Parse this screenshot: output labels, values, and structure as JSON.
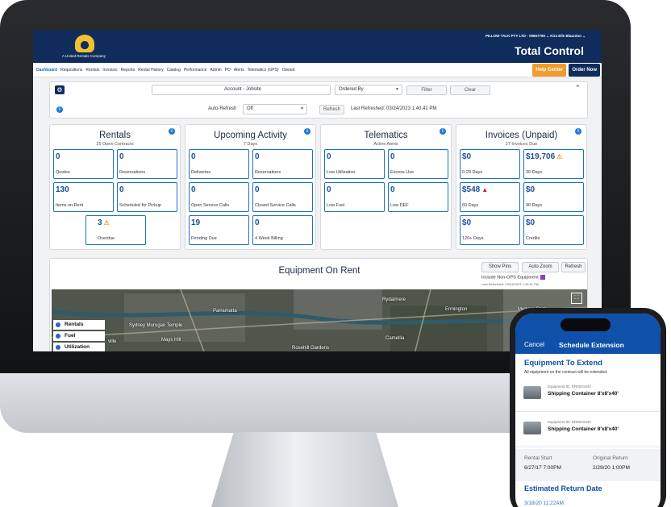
{
  "app": {
    "brand_subtitle": "A United Rentals Company",
    "account_menu": "PILLOW TALK PTY LTD - #8567790 ⌄   Kira Elle Blaunton ⌄",
    "title": "Total Control"
  },
  "nav": {
    "items": [
      "Dashboard",
      "Requisitions",
      "Rentals",
      "Invoices",
      "Reports",
      "Rental History",
      "Catalog",
      "Performance",
      "Admin",
      "PO",
      "Alerts",
      "Telematics (GPS)",
      "Owned"
    ],
    "help_center": "Help Center",
    "order_now": "Order Now"
  },
  "filters": {
    "account_jobsite_placeholder": "Account - Jobsite",
    "ordered_by": "Ordered By",
    "filter_button": "Filter",
    "clear_button": "Clear",
    "auto_refresh_label": "Auto-Refresh",
    "auto_refresh_value": "Off",
    "refresh_button": "Refresh",
    "last_refreshed": "Last Refreshed: 03/24/2023 1:40:41 PM"
  },
  "cards": {
    "rentals": {
      "title": "Rentals",
      "subtitle": "25 Open Contracts",
      "tiles": [
        {
          "value": "0",
          "label": "Quotes"
        },
        {
          "value": "0",
          "label": "Reservations"
        },
        {
          "value": "130",
          "label": "Items on Rent"
        },
        {
          "value": "0",
          "label": "Scheduled for Pickup"
        },
        {
          "value": "3",
          "label": "Overdue"
        }
      ]
    },
    "upcoming": {
      "title": "Upcoming Activity",
      "subtitle": "7 Days",
      "tiles": [
        {
          "value": "0",
          "label": "Deliveries"
        },
        {
          "value": "0",
          "label": "Reservations"
        },
        {
          "value": "0",
          "label": "Open Service Calls"
        },
        {
          "value": "0",
          "label": "Closed Service Calls"
        },
        {
          "value": "19",
          "label": "Pending Due"
        },
        {
          "value": "0",
          "label": "4 Week Billing"
        }
      ]
    },
    "telematics": {
      "title": "Telematics",
      "subtitle": "Active Alerts",
      "tiles": [
        {
          "value": "0",
          "label": "Low Utilization"
        },
        {
          "value": "0",
          "label": "Excess Use"
        },
        {
          "value": "0",
          "label": "Low Fuel"
        },
        {
          "value": "0",
          "label": "Low DEF"
        }
      ]
    },
    "invoices": {
      "title": "Invoices (Unpaid)",
      "subtitle": "27 Invoices Due",
      "tiles": [
        {
          "value": "$0",
          "label": "0-29 Days"
        },
        {
          "value": "$19,706",
          "label": "30 Days"
        },
        {
          "value": "$548",
          "label": "60 Days"
        },
        {
          "value": "$0",
          "label": "90 Days"
        },
        {
          "value": "$0",
          "label": "120+ Days"
        },
        {
          "value": "$0",
          "label": "Credits"
        }
      ]
    }
  },
  "equipment": {
    "title": "Equipment On Rent",
    "show_pins": "Show Pins",
    "auto_zoom": "Auto Zoom",
    "refresh": "Refresh",
    "include_non_gps": "Include Non-GPS Equipment",
    "last_refreshed": "Last Refreshed: 03/24/2023 1:40:41 PM",
    "legend": [
      "Rentals",
      "Fuel",
      "Utilization"
    ],
    "map_labels": [
      "Parramatta",
      "Sydney Murugan Temple",
      "Mays Hill",
      "Rydalmere",
      "Ermington",
      "Melrose Park",
      "Camellia",
      "Rosehill Gardens",
      "ville"
    ]
  },
  "phone": {
    "cancel": "Cancel",
    "title": "Schedule Extension",
    "heading": "Equipment To Extend",
    "note": "All equipment on the contract will be extended.",
    "items": [
      {
        "id": "Equipment ID:  RR8201940",
        "name": "Shipping Container 8'x8'x40'"
      },
      {
        "id": "Equipment ID:  RR8201940",
        "name": "Shipping Container 8'x8'x40'"
      }
    ],
    "rental_start_label": "Rental Start",
    "rental_start_value": "6/27/17 7:00PM",
    "original_return_label": "Original Return",
    "original_return_value": "2/29/20 1:00PM",
    "estimated_heading": "Estimated Return Date",
    "estimated_value": "3/18/20 11:22AM"
  },
  "colors": {
    "navy": "#0f2c5c",
    "accent_blue": "#1f6fc4",
    "help_orange": "#f39a2d",
    "warning_red": "#d32020",
    "phone_blue": "#0f50a8"
  },
  "icons": [
    "gear-icon",
    "info-icon",
    "warning-icon",
    "fullscreen-icon",
    "legend-dot-icon",
    "chevron-up-icon",
    "dropdown-caret-icon"
  ]
}
